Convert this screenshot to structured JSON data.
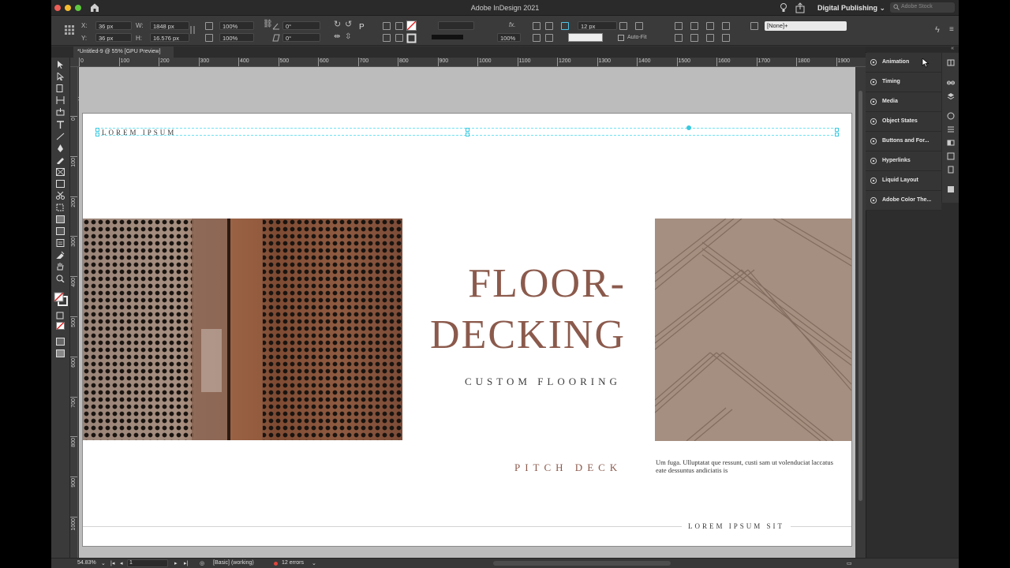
{
  "app": {
    "window_title": "Adobe InDesign 2021",
    "workspace": "Digital Publishing",
    "stock_search_placeholder": "Adobe Stock",
    "document_tab": "*Untitled-9 @ 55% [GPU Preview]"
  },
  "control_bar": {
    "x_label": "X:",
    "x_value": "36 px",
    "y_label": "Y:",
    "y_value": "36 px",
    "w_label": "W:",
    "w_value": "1848 px",
    "h_label": "H:",
    "h_value": "16.576 px",
    "scale_x": "100%",
    "scale_y": "100%",
    "rotate": "0°",
    "shear": "0°",
    "stroke_weight": "12 px",
    "opacity": "100%",
    "auto_fit_label": "Auto-Fit",
    "object_style": "[None]+"
  },
  "rulers": {
    "h_marks": [
      "0",
      "100",
      "200",
      "300",
      "400",
      "500",
      "600",
      "700",
      "800",
      "900",
      "1000",
      "1100",
      "1200",
      "1300",
      "1400",
      "1500",
      "1600",
      "1700",
      "1800",
      "1900"
    ],
    "v_marks": [
      "0",
      "100",
      "200",
      "300",
      "400",
      "500",
      "600",
      "700",
      "800",
      "900",
      "1000"
    ]
  },
  "page": {
    "eyebrow": "LOREM IPSUM",
    "headline_line1": "FLOOR-",
    "headline_line2": "DECKING",
    "subtitle": "CUSTOM FLOORING",
    "pitch": "PITCH DECK",
    "body": "Um fuga. Ulluptatat que ressunt, custi sam ut volenduciat laccatus eate dessuntus andiciatis is",
    "footer": "LOREM IPSUM SIT",
    "colors": {
      "accent": "#8b5a4c",
      "text": "#3d3d3d"
    }
  },
  "panels": [
    {
      "label": "Animation",
      "icon": "animation-icon"
    },
    {
      "label": "Timing",
      "icon": "timing-icon"
    },
    {
      "label": "Media",
      "icon": "media-icon"
    },
    {
      "label": "Object States",
      "icon": "object-states-icon"
    },
    {
      "label": "Buttons and For...",
      "icon": "buttons-forms-icon"
    },
    {
      "label": "Hyperlinks",
      "icon": "hyperlinks-icon"
    },
    {
      "label": "Liquid Layout",
      "icon": "liquid-layout-icon"
    },
    {
      "label": "Adobe Color The...",
      "icon": "color-themes-icon"
    }
  ],
  "status_bar": {
    "zoom": "54.83%",
    "page_number": "1",
    "preflight_profile": "[Basic] (working)",
    "errors": "12 errors"
  }
}
